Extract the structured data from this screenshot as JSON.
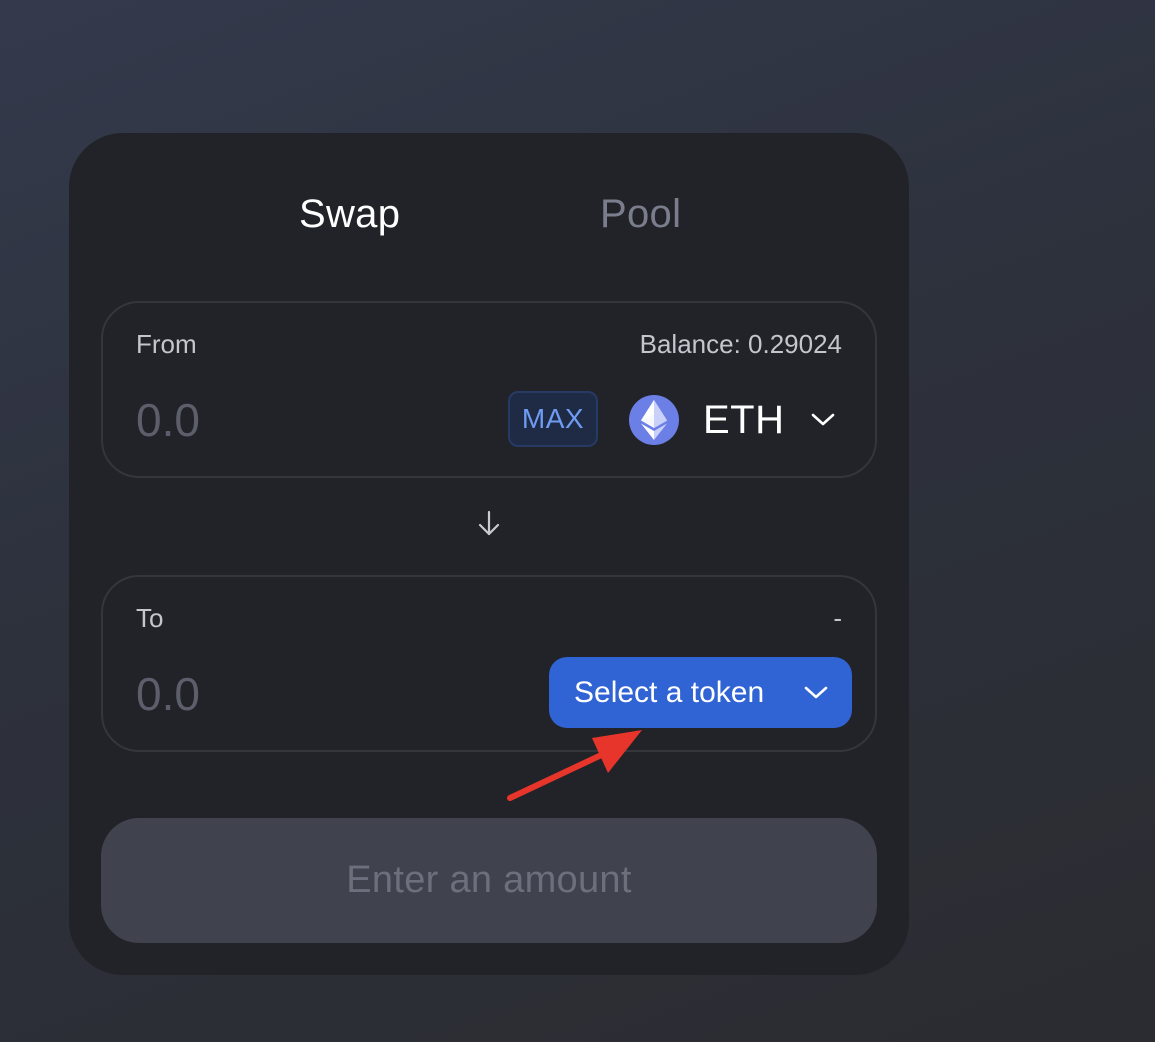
{
  "tabs": {
    "swap_label": "Swap",
    "pool_label": "Pool",
    "active": "Swap"
  },
  "from_panel": {
    "label": "From",
    "balance_text": "Balance: 0.29024",
    "amount_placeholder": "0.0",
    "max_label": "MAX",
    "token_symbol": "ETH",
    "token_icon": "ethereum-icon"
  },
  "switch_icon": "arrow-down-icon",
  "to_panel": {
    "label": "To",
    "balance_text": "-",
    "amount_placeholder": "0.0",
    "select_token_label": "Select a token"
  },
  "submit": {
    "label": "Enter an amount",
    "disabled": true
  },
  "annotation": {
    "icon": "red-pointer-arrow",
    "color": "#e8352b"
  },
  "colors": {
    "accent": "#3063d4",
    "max_text": "#6e9cf3",
    "eth_icon": "#6c7fe6"
  }
}
